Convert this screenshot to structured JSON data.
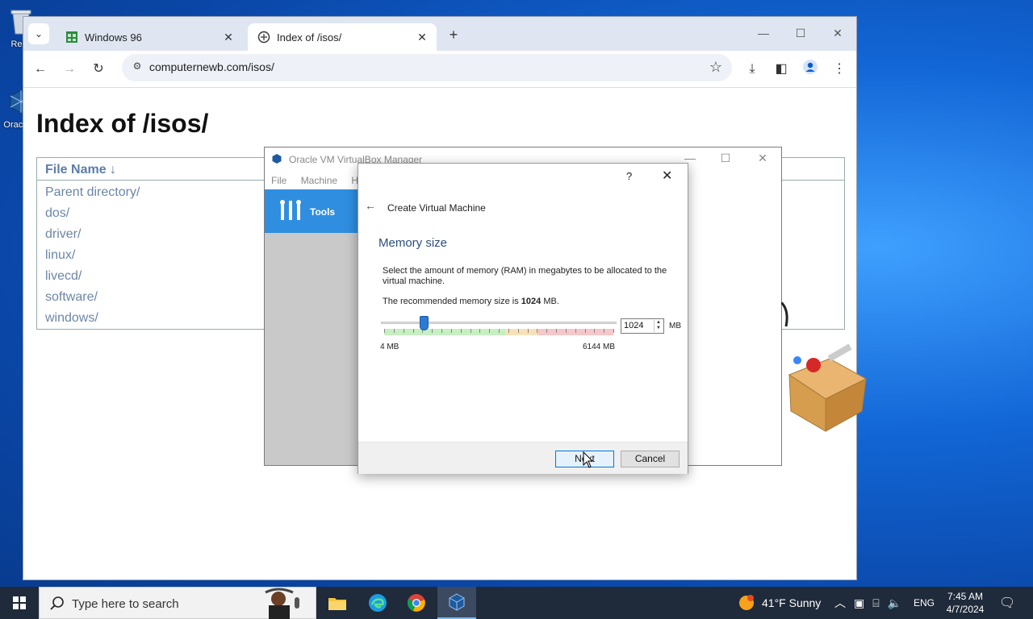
{
  "desktop": {
    "icons": [
      {
        "name": "recycle-bin",
        "label": "Recy"
      },
      {
        "name": "virtualbox",
        "label": "Orac Virt"
      }
    ]
  },
  "browser": {
    "tabs": [
      {
        "title": "Windows 96",
        "close": "✕"
      },
      {
        "title": "Index of /isos/",
        "close": "✕"
      }
    ],
    "new_tab": "+",
    "url": "computernewb.com/isos/"
  },
  "page": {
    "heading": "Index of /isos/",
    "table_header": "File Name ↓",
    "entries": [
      "Parent directory/",
      "dos/",
      "driver/",
      "linux/",
      "livecd/",
      "software/",
      "windows/"
    ]
  },
  "vbox_manager": {
    "title": "Oracle VM VirtualBox Manager",
    "menu": [
      "File",
      "Machine",
      "He"
    ],
    "tools_label": "Tools"
  },
  "dialog": {
    "help": "?",
    "title": "Create Virtual Machine",
    "section": "Memory size",
    "description": "Select the amount of memory (RAM) in megabytes to be allocated to the virtual machine.",
    "recommended_prefix": "The recommended memory size is ",
    "recommended_value": "1024",
    "recommended_suffix": " MB.",
    "memory_value": "1024",
    "unit": "MB",
    "min_label": "4 MB",
    "max_label": "6144 MB",
    "slider_min": 4,
    "slider_max": 6144,
    "slider_fraction": 0.18,
    "next_label": "Next",
    "cancel_label": "Cancel"
  },
  "taskbar": {
    "search_placeholder": "Type here to search",
    "weather": "41°F  Sunny",
    "language": "ENG",
    "time": "7:45 AM",
    "date": "4/7/2024"
  },
  "colors": {
    "accent": "#2a7bd4",
    "tools_bg": "#2f8ee0",
    "link": "#6b86a8"
  }
}
